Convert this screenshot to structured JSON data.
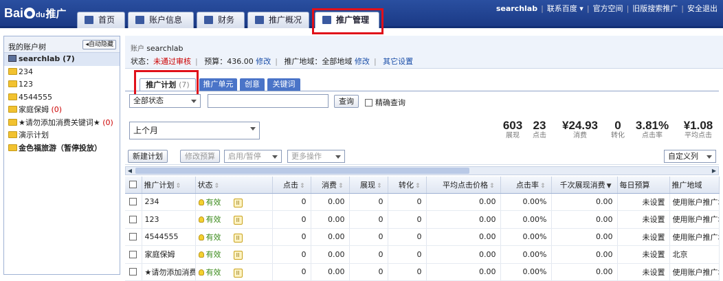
{
  "topnav": {
    "logo_text": "Bai",
    "logo_suffix": "du",
    "logo_tag": "推广",
    "tabs": [
      {
        "label": "首页",
        "icon": "home-icon"
      },
      {
        "label": "账户信息",
        "icon": "user-icon"
      },
      {
        "label": "财务",
        "icon": "card-icon"
      },
      {
        "label": "推广概况",
        "icon": "chart-icon"
      },
      {
        "label": "推广管理",
        "icon": "list-icon",
        "active": true
      }
    ],
    "user": "searchlab",
    "links": [
      "联系百度 ▾",
      "官方空间",
      "旧版搜索推广",
      "安全退出"
    ]
  },
  "sidebar": {
    "title": "我的账户树",
    "toggle_label": "自动隐藏",
    "root": "searchlab (7)",
    "items": [
      {
        "label": "234",
        "count": ""
      },
      {
        "label": "123",
        "count": ""
      },
      {
        "label": "4544555",
        "count": ""
      },
      {
        "label": "家庭保姆 ",
        "count": "(0)"
      },
      {
        "label": "★请勿添加消费关键词★ ",
        "count": "(0)"
      },
      {
        "label": "演示计划",
        "count": ""
      },
      {
        "label": "金色福旅游（暂停投放）",
        "count": ""
      }
    ]
  },
  "account": {
    "label": "账户",
    "name": "searchlab",
    "status_label": "状态：",
    "status_value": "未通过审核",
    "budget_label": "预算：436.00",
    "edit1": "修改",
    "region_label": "推广地域：全部地域",
    "edit2": "修改",
    "other": "其它设置"
  },
  "subtabs": [
    {
      "label": "推广计划",
      "count": "(7)",
      "active": true
    },
    {
      "label": "推广单元"
    },
    {
      "label": "创意"
    },
    {
      "label": "关键词"
    }
  ],
  "filter": {
    "status_select": "全部状态",
    "search_placeholder": "",
    "search_button": "查询",
    "exact_label": "精确查询",
    "period_select": "上个月"
  },
  "stats": [
    {
      "value": "603",
      "label": "展现"
    },
    {
      "value": "23",
      "label": "点击"
    },
    {
      "value": "¥24.93",
      "label": "消费"
    },
    {
      "value": "0",
      "label": "转化"
    },
    {
      "value": "3.81%",
      "label": "点击率"
    },
    {
      "value": "¥1.08",
      "label": "平均点击"
    }
  ],
  "toolbar": {
    "new_plan": "新建计划",
    "edit_budget": "修改预算",
    "enable_pause": "启用/暂停",
    "more_ops": "更多操作",
    "custom_columns": "自定义列"
  },
  "table": {
    "headers": [
      "推广计划",
      "状态",
      "点击",
      "消费",
      "展现",
      "转化",
      "平均点击价格",
      "点击率",
      "千次展现消费",
      "每日预算",
      "推广地域"
    ],
    "rows": [
      {
        "name": "234",
        "status": "有效",
        "clicks": "0",
        "cost": "0.00",
        "impr": "0",
        "conv": "0",
        "avg_cpc": "0.00",
        "ctr": "0.00%",
        "cpm": "0.00",
        "budget": "未设置",
        "region": "使用账户推广地域"
      },
      {
        "name": "123",
        "status": "有效",
        "clicks": "0",
        "cost": "0.00",
        "impr": "0",
        "conv": "0",
        "avg_cpc": "0.00",
        "ctr": "0.00%",
        "cpm": "0.00",
        "budget": "未设置",
        "region": "使用账户推广地域"
      },
      {
        "name": "4544555",
        "status": "有效",
        "clicks": "0",
        "cost": "0.00",
        "impr": "0",
        "conv": "0",
        "avg_cpc": "0.00",
        "ctr": "0.00%",
        "cpm": "0.00",
        "budget": "未设置",
        "region": "使用账户推广地域"
      },
      {
        "name": "家庭保姆",
        "status": "有效",
        "clicks": "0",
        "cost": "0.00",
        "impr": "0",
        "conv": "0",
        "avg_cpc": "0.00",
        "ctr": "0.00%",
        "cpm": "0.00",
        "budget": "未设置",
        "region": "北京"
      },
      {
        "name": "★请勿添加消费",
        "status": "有效",
        "clicks": "0",
        "cost": "0.00",
        "impr": "0",
        "conv": "0",
        "avg_cpc": "0.00",
        "ctr": "0.00%",
        "cpm": "0.00",
        "budget": "未设置",
        "region": "使用账户推广地域"
      }
    ]
  },
  "colors": {
    "nav_bg": "#1b3a86",
    "highlight": "#e0101a",
    "link": "#1a4ea8"
  }
}
